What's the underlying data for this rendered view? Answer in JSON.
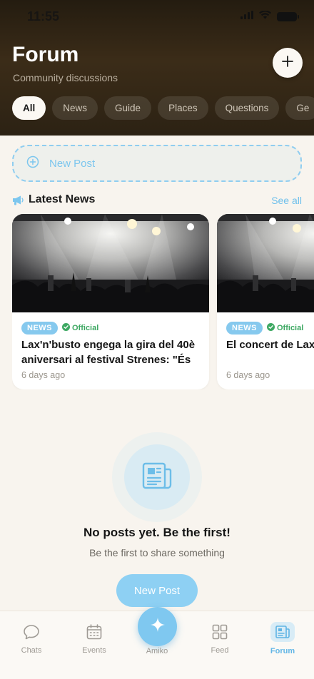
{
  "status_bar": {
    "time": "11:55"
  },
  "header": {
    "title": "Forum",
    "subtitle": "Community discussions",
    "add_icon": "plus-icon",
    "bg_color": "#2c2214"
  },
  "filters": [
    {
      "label": "All",
      "active": true
    },
    {
      "label": "News",
      "active": false
    },
    {
      "label": "Guide",
      "active": false
    },
    {
      "label": "Places",
      "active": false
    },
    {
      "label": "Questions",
      "active": false
    },
    {
      "label": "Ge",
      "active": false
    }
  ],
  "compose": {
    "label": "New Post",
    "icon": "plus-circle-icon"
  },
  "latest_news": {
    "title": "Latest News",
    "icon": "megaphone-icon",
    "see_all": "See all",
    "cards": [
      {
        "badge": "NEWS",
        "official": "Official",
        "headline": "Lax'n'busto engega la gira del 40è aniversari al festival Strenes: \"És u…",
        "age": "6 days ago"
      },
      {
        "badge": "NEWS",
        "official": "Official",
        "headline": "El concert de Lax'n'busto Strenes",
        "age": "6 days ago"
      }
    ]
  },
  "empty_state": {
    "icon": "newspaper-icon",
    "title": "No posts yet. Be the first!",
    "subtitle": "Be the first to share something",
    "button": "New Post"
  },
  "tabbar": {
    "tabs": [
      {
        "label": "Chats",
        "icon": "chat-bubble-icon",
        "active": false
      },
      {
        "label": "Events",
        "icon": "calendar-icon",
        "active": false
      },
      {
        "label": "Amiko",
        "icon": "sparkle-icon",
        "active": false
      },
      {
        "label": "Feed",
        "icon": "grid-icon",
        "active": false
      },
      {
        "label": "Forum",
        "icon": "newspaper-icon",
        "active": true
      }
    ]
  },
  "colors": {
    "accent": "#7fc8f0",
    "official": "#3da862",
    "background": "#f8f4ee"
  }
}
